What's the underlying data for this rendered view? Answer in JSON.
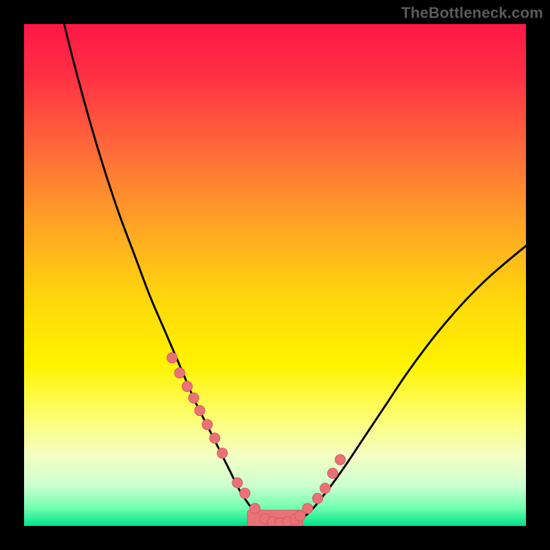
{
  "watermark": "TheBottleneck.com",
  "colors": {
    "frame": "#000000",
    "curve": "#000000",
    "marker_fill": "#e97277",
    "marker_stroke": "#d85a61",
    "gradient_stops": [
      {
        "offset": 0.0,
        "color": "#ff1846"
      },
      {
        "offset": 0.1,
        "color": "#ff2f44"
      },
      {
        "offset": 0.25,
        "color": "#ff6a3a"
      },
      {
        "offset": 0.4,
        "color": "#ffa425"
      },
      {
        "offset": 0.55,
        "color": "#ffd80b"
      },
      {
        "offset": 0.68,
        "color": "#fff300"
      },
      {
        "offset": 0.78,
        "color": "#fdfd6e"
      },
      {
        "offset": 0.86,
        "color": "#f4ffc4"
      },
      {
        "offset": 0.92,
        "color": "#ccffcf"
      },
      {
        "offset": 0.965,
        "color": "#6fffb0"
      },
      {
        "offset": 1.0,
        "color": "#00e28a"
      }
    ]
  },
  "chart_data": {
    "type": "line",
    "title": "",
    "xlabel": "",
    "ylabel": "",
    "xlim": [
      0,
      100
    ],
    "ylim": [
      0,
      100
    ],
    "grid": false,
    "legend": false,
    "series": [
      {
        "name": "bottleneck-curve",
        "x": [
          8,
          10,
          13,
          16,
          19,
          22,
          25,
          28,
          31,
          34,
          36.5,
          39,
          41,
          43,
          45,
          47,
          49,
          52,
          56,
          60,
          64,
          68,
          72,
          76,
          80,
          84,
          88,
          92,
          96,
          100
        ],
        "y": [
          100,
          92,
          81,
          71,
          62,
          54,
          46,
          39,
          32,
          25,
          20,
          15,
          11,
          7,
          4,
          1.5,
          0.5,
          0.5,
          2,
          6.5,
          12,
          18,
          24,
          30,
          35.5,
          40.5,
          45,
          49,
          52.5,
          55.8
        ]
      }
    ],
    "markers": {
      "name": "highlighted-points",
      "x": [
        29.5,
        31,
        32.5,
        33.8,
        35,
        36.5,
        38,
        39.5,
        42.5,
        44,
        46,
        48,
        49.5,
        51,
        52.5,
        54,
        55,
        56.5,
        58.5,
        60,
        61.5,
        63
      ],
      "y": [
        33.5,
        30.5,
        27.8,
        25.5,
        23,
        20.2,
        17.5,
        14.5,
        8.6,
        6.5,
        3.5,
        1.4,
        0.8,
        0.6,
        0.8,
        1.3,
        2.0,
        3.5,
        5.5,
        7.5,
        10.5,
        13.2
      ]
    },
    "flat_bar": {
      "x0": 44.5,
      "x1": 55.5,
      "y": 0.9,
      "thickness": 4.5
    }
  }
}
